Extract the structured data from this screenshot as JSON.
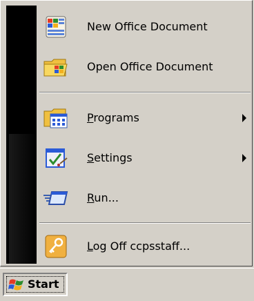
{
  "menu": {
    "items": [
      {
        "label": "New Office Document",
        "icon": "new-office-document-icon",
        "has_submenu": false,
        "accel": ""
      },
      {
        "label": "Open Office Document",
        "icon": "open-office-document-icon",
        "has_submenu": false,
        "accel": ""
      },
      {
        "label_accel": "P",
        "label_rest": "rograms",
        "icon": "programs-icon",
        "has_submenu": true
      },
      {
        "label_accel": "S",
        "label_rest": "ettings",
        "icon": "settings-icon",
        "has_submenu": true
      },
      {
        "label_accel": "R",
        "label_rest": "un...",
        "icon": "run-icon",
        "has_submenu": false
      },
      {
        "label_accel": "L",
        "label_rest": "og Off ccpsstaff...",
        "icon": "log-off-key-icon",
        "has_submenu": false
      }
    ]
  },
  "taskbar": {
    "start_label": "Start"
  }
}
